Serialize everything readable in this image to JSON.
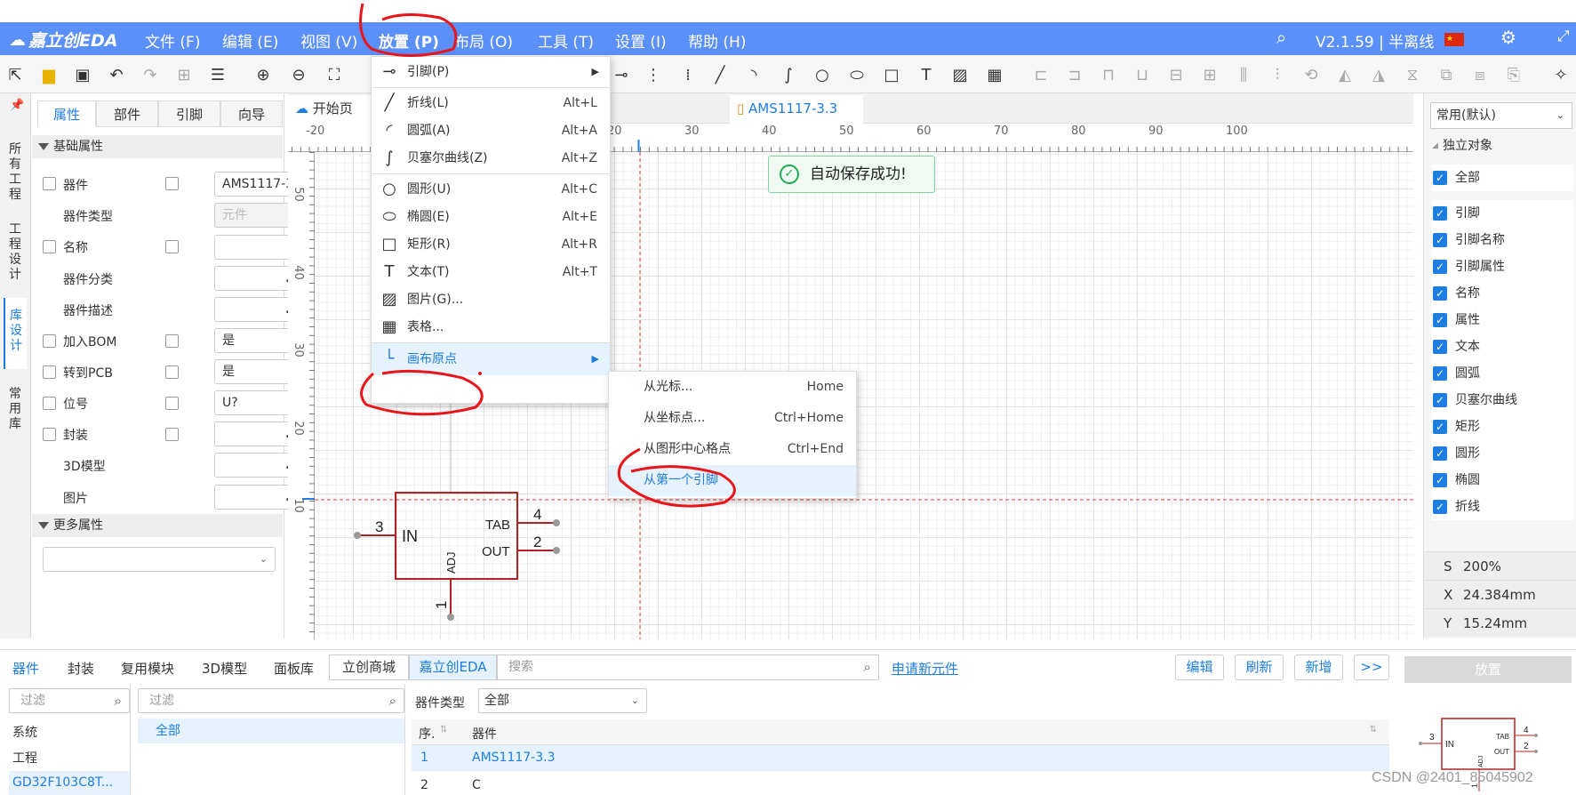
{
  "app": {
    "logo_text": "嘉立创EDA",
    "version": "V2.1.59 | 半离线"
  },
  "menubar": [
    {
      "label": "文件 (F)"
    },
    {
      "label": "编辑 (E)"
    },
    {
      "label": "视图 (V)"
    },
    {
      "label": "放置 (P)"
    },
    {
      "label": "布局 (O)"
    },
    {
      "label": "工具 (T)"
    },
    {
      "label": "设置 (I)"
    },
    {
      "label": "帮助 (H)"
    }
  ],
  "left_strip": {
    "tabs": [
      "所有工程",
      "工程设计",
      "库设计",
      "常用库"
    ]
  },
  "properties": {
    "tabs": [
      "属性",
      "部件",
      "引脚",
      "向导"
    ],
    "section_basic": "基础属性",
    "rows": [
      {
        "label": "器件",
        "value": "AMS1117-3"
      },
      {
        "label": "器件类型",
        "value": "元件"
      },
      {
        "label": "名称",
        "value": ""
      },
      {
        "label": "器件分类",
        "value": "..."
      },
      {
        "label": "器件描述",
        "value": "..."
      },
      {
        "label": "加入BOM",
        "value": "是"
      },
      {
        "label": "转到PCB",
        "value": "是"
      },
      {
        "label": "位号",
        "value": "U?"
      },
      {
        "label": "封装",
        "value": "..."
      },
      {
        "label": "3D模型",
        "value": "..."
      },
      {
        "label": "图片",
        "value": "..."
      }
    ],
    "section_more": "更多属性"
  },
  "doc_tabs": [
    {
      "label": "开始页"
    },
    {
      "label": "AMS1117-3.3"
    }
  ],
  "ruler": {
    "top": [
      "-20",
      "20",
      "30",
      "40",
      "50",
      "60",
      "70",
      "80",
      "90",
      "100"
    ],
    "left": [
      "50",
      "40",
      "30",
      "20",
      "10"
    ]
  },
  "toast": "自动保存成功!",
  "symbol": {
    "pins": [
      {
        "num": "3",
        "name": "IN"
      },
      {
        "num": "4",
        "name": "TAB"
      },
      {
        "num": "2",
        "name": "OUT"
      },
      {
        "num": "1",
        "name": "ADJ"
      }
    ]
  },
  "place_menu": {
    "items": [
      {
        "label": "引脚(P)",
        "shortcut": "",
        "icon": "pin-icon",
        "glyph": "⊸"
      },
      {
        "label": "折线(L)",
        "shortcut": "Alt+L",
        "icon": "polyline-icon",
        "glyph": "╱"
      },
      {
        "label": "圆弧(A)",
        "shortcut": "Alt+A",
        "icon": "arc-icon",
        "glyph": "◜"
      },
      {
        "label": "贝塞尔曲线(Z)",
        "shortcut": "Alt+Z",
        "icon": "bezier-icon",
        "glyph": "∫"
      },
      {
        "label": "圆形(U)",
        "shortcut": "Alt+C",
        "icon": "circle-icon",
        "glyph": "○"
      },
      {
        "label": "椭圆(E)",
        "shortcut": "Alt+E",
        "icon": "ellipse-icon",
        "glyph": "⬭"
      },
      {
        "label": "矩形(R)",
        "shortcut": "Alt+R",
        "icon": "rectangle-icon",
        "glyph": "□"
      },
      {
        "label": "文本(T)",
        "shortcut": "Alt+T",
        "icon": "text-icon",
        "glyph": "T"
      },
      {
        "label": "图片(G)...",
        "shortcut": "",
        "icon": "image-icon",
        "glyph": "▨"
      },
      {
        "label": "表格...",
        "shortcut": "",
        "icon": "table-icon",
        "glyph": "▦"
      },
      {
        "label": "画布原点",
        "shortcut": "",
        "icon": "origin-icon",
        "glyph": "└"
      }
    ]
  },
  "origin_submenu": {
    "items": [
      {
        "label": "从光标...",
        "shortcut": "Home"
      },
      {
        "label": "从坐标点...",
        "shortcut": "Ctrl+Home"
      },
      {
        "label": "从图形中心格点",
        "shortcut": "Ctrl+End"
      },
      {
        "label": "从第一个引脚",
        "shortcut": ""
      }
    ]
  },
  "right_panel": {
    "preset": "常用(默认)",
    "group": "独立对象",
    "items": [
      "全部",
      "引脚",
      "引脚名称",
      "引脚属性",
      "名称",
      "属性",
      "文本",
      "圆弧",
      "贝塞尔曲线",
      "矩形",
      "圆形",
      "椭圆",
      "折线"
    ],
    "info": [
      {
        "k": "S",
        "v": "200%"
      },
      {
        "k": "X",
        "v": "24.384mm"
      },
      {
        "k": "Y",
        "v": "15.24mm"
      }
    ]
  },
  "bottom": {
    "tabs": [
      "器件",
      "封装",
      "复用模块",
      "3D模型",
      "面板库"
    ],
    "sources": [
      "立创商城",
      "嘉立创EDA"
    ],
    "search_placeholder": "搜索",
    "apply_link": "申请新元件",
    "buttons": [
      "编辑",
      "刷新",
      "新增",
      ">>"
    ],
    "filter_placeholder": "过滤",
    "tree": [
      "系统",
      "工程",
      "GD32F103C8T..."
    ],
    "category_all": "全部",
    "type_label": "器件类型",
    "type_value": "全部",
    "columns": [
      "序.",
      "器件"
    ],
    "rows": [
      {
        "idx": "1",
        "name": "AMS1117-3.3"
      },
      {
        "idx": "2",
        "name": "C"
      }
    ],
    "place_button": "放置",
    "preview_pins": [
      "3",
      "IN",
      "TAB",
      "4",
      "OUT",
      "2",
      "ADJ",
      "1"
    ]
  },
  "watermark": "CSDN @2401_85045902"
}
